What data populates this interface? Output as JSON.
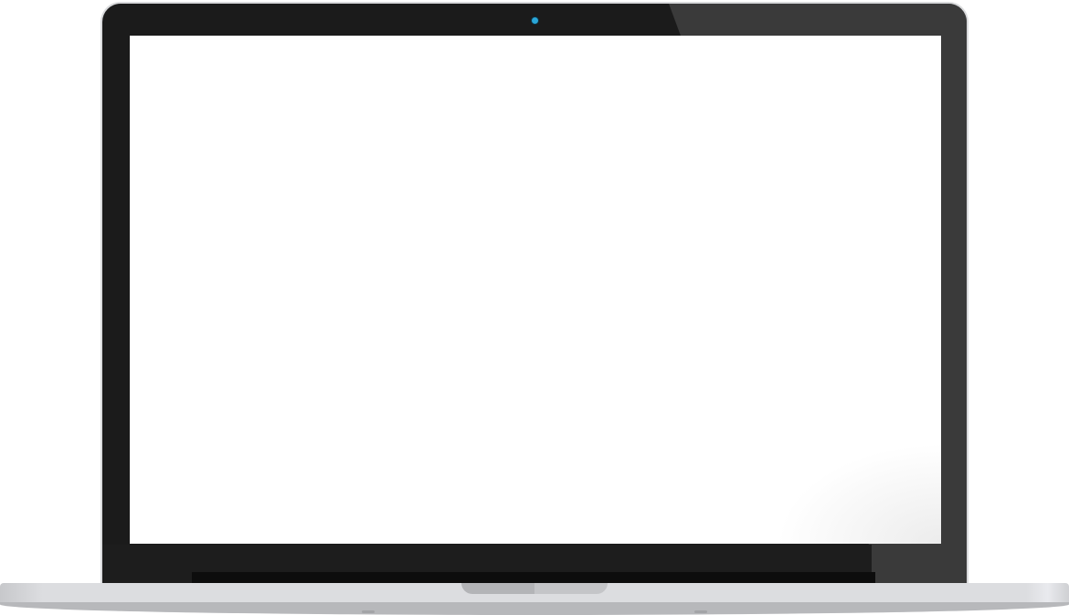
{
  "device": {
    "type": "laptop",
    "screen_color": "#ffffff",
    "bezel_color": "#1b1b1b",
    "bezel_gloss_color": "#3a3a3a",
    "body_color": "#dcdde0",
    "camera_color": "#2aa6d8"
  }
}
